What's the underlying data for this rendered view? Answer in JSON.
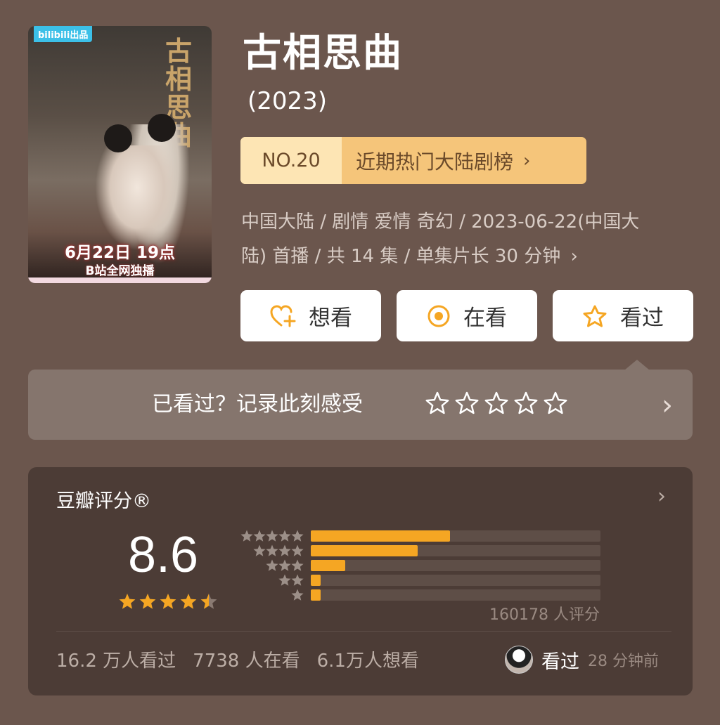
{
  "poster": {
    "logo": "bilibili出品",
    "calligraphy": "古相思曲",
    "premiere": "6月22日 19点",
    "exclusive": "B站全网独播"
  },
  "title": "古相思曲",
  "year": "(2023)",
  "rank": {
    "number": "NO.20",
    "label": "近期热门大陆剧榜",
    "chevron": "›"
  },
  "meta": {
    "line1": "中国大陆 / 剧情 爱情 奇幻 / 2023-06-22(中国大",
    "line2": "陆) 首播 / 共 14 集 / 单集片长 30 分钟",
    "chevron": "›"
  },
  "actions": [
    {
      "label": "想看",
      "icon": "heart-plus-icon"
    },
    {
      "label": "在看",
      "icon": "circle-dot-icon"
    },
    {
      "label": "看过",
      "icon": "star-outline-icon"
    }
  ],
  "record": {
    "prompt": "已看过？记录此刻感受",
    "stars": 5,
    "chevron": "›"
  },
  "rating": {
    "heading": "豆瓣评分®",
    "score": "8.6",
    "stars_value": 4.5,
    "distribution": [
      {
        "stars": 5,
        "fraction": 0.48
      },
      {
        "stars": 4,
        "fraction": 0.37
      },
      {
        "stars": 3,
        "fraction": 0.12
      },
      {
        "stars": 2,
        "fraction": 0.035
      },
      {
        "stars": 1,
        "fraction": 0.035
      }
    ],
    "count_text": "160178 人评分",
    "chevron": "›",
    "stats": {
      "watched": "16.2 万人看过",
      "watching": "7738 人在看",
      "want": "6.1万人想看"
    },
    "friend": {
      "status": "看过",
      "time": "28 分钟前"
    }
  },
  "colors": {
    "background": "#6b564d",
    "accent": "#f5a623",
    "rank_bg": "#f5c57a"
  }
}
